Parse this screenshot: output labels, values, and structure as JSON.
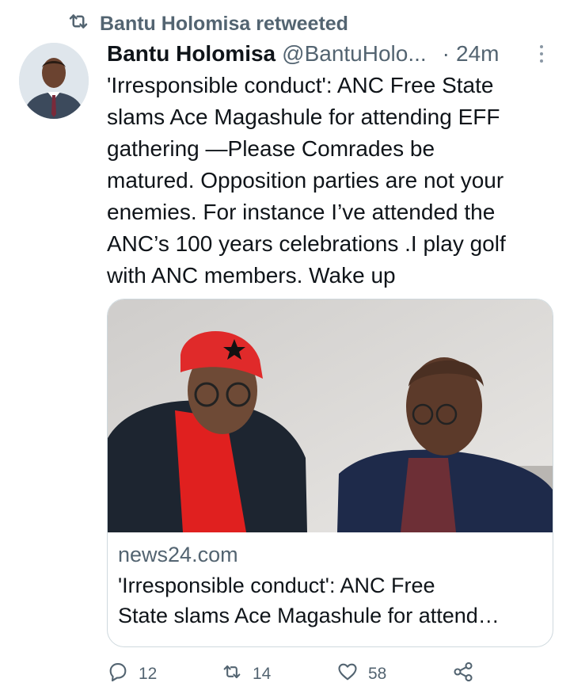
{
  "social_context": {
    "text": "Bantu Holomisa retweeted"
  },
  "tweet": {
    "author_name": "Bantu Holomisa",
    "handle": "@BantuHolo...",
    "separator": "·",
    "time": "24m",
    "text": "'Irresponsible conduct': ANC Free State\nslams Ace Magashule for attending EFF\ngathering —Please Comrades be\nmatured. Opposition parties are not your\nenemies. For instance I’ve attended the\nANC’s 100 years celebrations .I play golf\nwith ANC members. Wake up"
  },
  "card": {
    "domain": "news24.com",
    "title": "'Irresponsible conduct': ANC Free\nState slams Ace Magashule for attend…"
  },
  "actions": {
    "replies": "12",
    "retweets": "14",
    "likes": "58"
  },
  "colors": {
    "secondary_text": "#536471",
    "border": "#cfd9de",
    "primary_text": "#0f1419"
  },
  "icons": [
    "retweet-icon",
    "more-icon",
    "reply-icon",
    "like-icon",
    "share-icon"
  ]
}
